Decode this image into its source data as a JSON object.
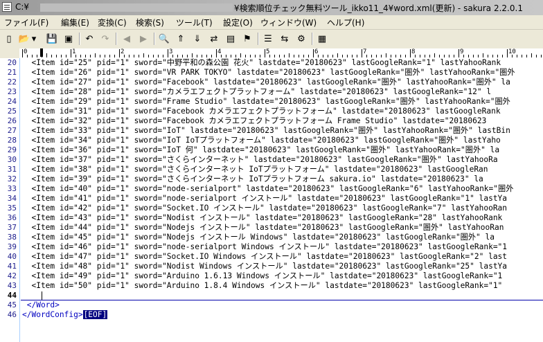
{
  "window": {
    "path_prefix": "C:¥",
    "title_suffix": "¥検索順位チェック無料ツール_ikko11_4¥word.xml(更新) - sakura 2.2.0.1"
  },
  "menu": [
    "ファイル(F)",
    "編集(E)",
    "変換(C)",
    "検索(S)",
    "ツール(T)",
    "設定(O)",
    "ウィンドウ(W)",
    "ヘルプ(H)"
  ],
  "toolbar": [
    {
      "name": "new-file-icon",
      "glyph": "▯"
    },
    {
      "name": "open-folder-icon",
      "glyph": "📂"
    },
    {
      "name": "dropdown-arrow-icon",
      "glyph": "▾"
    },
    {
      "name": "save-icon",
      "glyph": "💾"
    },
    {
      "name": "save-all-icon",
      "glyph": "▣"
    },
    {
      "name": "undo-icon",
      "glyph": "↶"
    },
    {
      "name": "redo-icon",
      "glyph": "↷"
    },
    {
      "name": "jump-back-icon",
      "glyph": "◀"
    },
    {
      "name": "jump-forward-icon",
      "glyph": "▶"
    },
    {
      "name": "search-icon",
      "glyph": "🔍"
    },
    {
      "name": "search-prev-icon",
      "glyph": "⇑"
    },
    {
      "name": "search-next-icon",
      "glyph": "⇓"
    },
    {
      "name": "replace-icon",
      "glyph": "⇄"
    },
    {
      "name": "grep-icon",
      "glyph": "▤"
    },
    {
      "name": "bookmark-icon",
      "glyph": "⚑"
    },
    {
      "name": "outline-icon",
      "glyph": "☰"
    },
    {
      "name": "compare-icon",
      "glyph": "⇆"
    },
    {
      "name": "settings-icon",
      "glyph": "⚙"
    }
  ],
  "ruler": {
    "labels": [
      "0",
      "1",
      "2",
      "3",
      "4",
      "5",
      "6",
      "7",
      "8",
      "9",
      "10"
    ]
  },
  "editor": {
    "current_line": 44,
    "eof_label": "[EOF]",
    "lines": [
      {
        "n": "20",
        "text": "  <Item id=\"25\" pid=\"1\" sword=\"中野平和の森公園 花火\" lastdate=\"20180623\" lastGoogleRank=\"1\" lastYahooRank"
      },
      {
        "n": "21",
        "text": "  <Item id=\"26\" pid=\"1\" sword=\"VR PARK TOKYO\" lastdate=\"20180623\" lastGoogleRank=\"圏外\" lastYahooRank=\"圏外"
      },
      {
        "n": "22",
        "text": "  <Item id=\"27\" pid=\"1\" sword=\"Facebook\" lastdate=\"20180623\" lastGoogleRank=\"圏外\" lastYahooRank=\"圏外\" la"
      },
      {
        "n": "23",
        "text": "  <Item id=\"28\" pid=\"1\" sword=\"カメラエフェクトプラットフォーム\" lastdate=\"20180623\" lastGoogleRank=\"12\" l"
      },
      {
        "n": "24",
        "text": "  <Item id=\"29\" pid=\"1\" sword=\"Frame Studio\" lastdate=\"20180623\" lastGoogleRank=\"圏外\" lastYahooRank=\"圏外"
      },
      {
        "n": "25",
        "text": "  <Item id=\"31\" pid=\"1\" sword=\"Facebook カメラエフェクトプラットフォーム\" lastdate=\"20180623\" lastGoogleRank"
      },
      {
        "n": "26",
        "text": "  <Item id=\"32\" pid=\"1\" sword=\"Facebook カメラエフェクトプラットフォーム Frame Studio\" lastdate=\"20180623"
      },
      {
        "n": "27",
        "text": "  <Item id=\"33\" pid=\"1\" sword=\"IoT\" lastdate=\"20180623\" lastGoogleRank=\"圏外\" lastYahooRank=\"圏外\" lastBin"
      },
      {
        "n": "28",
        "text": "  <Item id=\"34\" pid=\"1\" sword=\"IoT IoTプラットフォーム\" lastdate=\"20180623\" lastGoogleRank=\"圏外\" lastYaho"
      },
      {
        "n": "29",
        "text": "  <Item id=\"36\" pid=\"1\" sword=\"IoT 何\" lastdate=\"20180623\" lastGoogleRank=\"圏外\" lastYahooRank=\"圏外\" la"
      },
      {
        "n": "30",
        "text": "  <Item id=\"37\" pid=\"1\" sword=\"さくらインターネット\" lastdate=\"20180623\" lastGoogleRank=\"圏外\" lastYahooRa"
      },
      {
        "n": "31",
        "text": "  <Item id=\"38\" pid=\"1\" sword=\"さくらインターネット IoTプラットフォーム\" lastdate=\"20180623\" lastGoogleRan"
      },
      {
        "n": "32",
        "text": "  <Item id=\"39\" pid=\"1\" sword=\"さくらインターネット IoTプラットフォーム sakura.io\" lastdate=\"20180623\" la"
      },
      {
        "n": "33",
        "text": "  <Item id=\"40\" pid=\"1\" sword=\"node-serialport\" lastdate=\"20180623\" lastGoogleRank=\"6\" lastYahooRank=\"圏外"
      },
      {
        "n": "34",
        "text": "  <Item id=\"41\" pid=\"1\" sword=\"node-serialport インストール\" lastdate=\"20180623\" lastGoogleRank=\"1\" lastYa"
      },
      {
        "n": "35",
        "text": "  <Item id=\"42\" pid=\"1\" sword=\"Socket.IO インストール\" lastdate=\"20180623\" lastGoogleRank=\"7\" lastYahooRan"
      },
      {
        "n": "36",
        "text": "  <Item id=\"43\" pid=\"1\" sword=\"Nodist インストール\" lastdate=\"20180623\" lastGoogleRank=\"28\" lastYahooRank"
      },
      {
        "n": "37",
        "text": "  <Item id=\"44\" pid=\"1\" sword=\"Nodejs インストール\" lastdate=\"20180623\" lastGoogleRank=\"圏外\" lastYahooRan"
      },
      {
        "n": "38",
        "text": "  <Item id=\"45\" pid=\"1\" sword=\"Nodejs インストール Windows\" lastdate=\"20180623\" lastGoogleRank=\"圏外\" la"
      },
      {
        "n": "39",
        "text": "  <Item id=\"46\" pid=\"1\" sword=\"node-serialport Windows インストール\" lastdate=\"20180623\" lastGoogleRank=\"1"
      },
      {
        "n": "40",
        "text": "  <Item id=\"47\" pid=\"1\" sword=\"Socket.IO Windows インストール\" lastdate=\"20180623\" lastGoogleRank=\"2\" last"
      },
      {
        "n": "41",
        "text": "  <Item id=\"48\" pid=\"1\" sword=\"Nodist Windows インストール\" lastdate=\"20180623\" lastGoogleRank=\"25\" lastYa"
      },
      {
        "n": "42",
        "text": "  <Item id=\"49\" pid=\"1\" sword=\"Arduino 1.6.13 Windows インストール\" lastdate=\"20180623\" lastGoogleRank=\"1"
      },
      {
        "n": "43",
        "text": "  <Item id=\"50\" pid=\"1\" sword=\"Arduino 1.8.4 Windows インストール\" lastdate=\"20180623\" lastGoogleRank=\"1\" "
      },
      {
        "n": "44",
        "text": "  "
      },
      {
        "n": "45",
        "text": " </Word>"
      },
      {
        "n": "46",
        "text": "</WordConfig>"
      }
    ]
  }
}
